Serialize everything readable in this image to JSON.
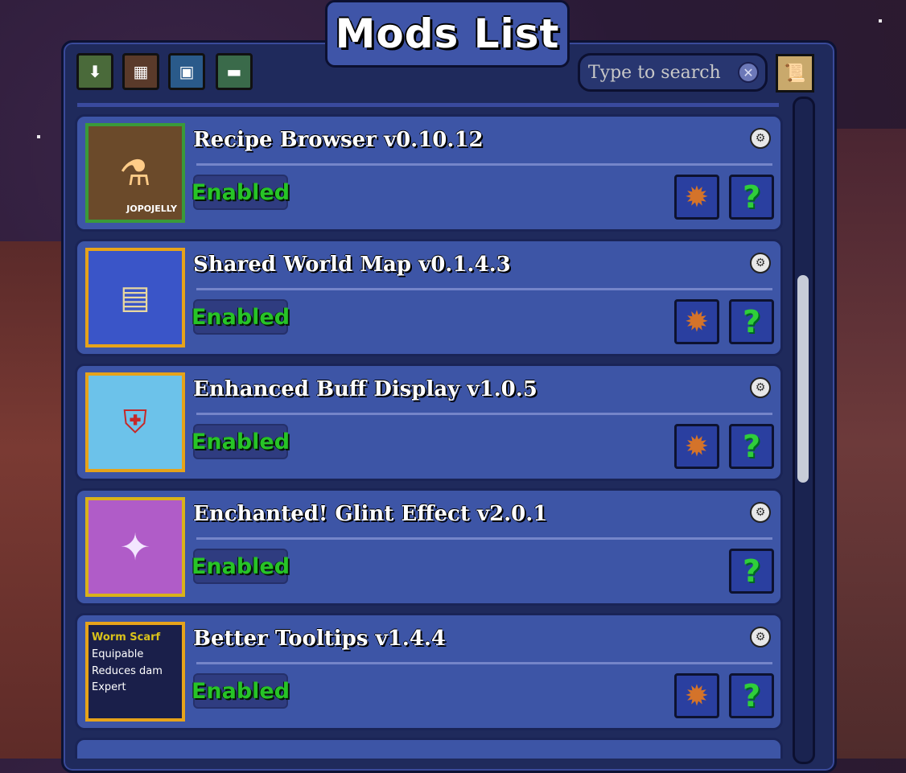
{
  "title": "Mods List",
  "toolbar": {
    "icons": [
      "download-mods-icon",
      "mod-browser-icon",
      "mod-sources-icon",
      "mod-pack-icon"
    ]
  },
  "search": {
    "placeholder": "Type to search",
    "value": ""
  },
  "mods": [
    {
      "name": "Recipe Browser v0.10.12",
      "status": "Enabled",
      "has_config": true,
      "thumb_label": "JOPOJELLY",
      "border": "#3a9a3a",
      "bg": "#6b4a2a"
    },
    {
      "name": "Shared World Map v0.1.4.3",
      "status": "Enabled",
      "has_config": true,
      "thumb_label": "",
      "border": "#e6a31a",
      "bg": "#3a55c8"
    },
    {
      "name": "Enhanced Buff Display v1.0.5",
      "status": "Enabled",
      "has_config": true,
      "thumb_label": "",
      "border": "#e6a31a",
      "bg": "#6cc2ea"
    },
    {
      "name": "Enchanted! Glint Effect v2.0.1",
      "status": "Enabled",
      "has_config": false,
      "thumb_label": "",
      "border": "#d9b21a",
      "bg": "#b05cc8"
    },
    {
      "name": "Better Tooltips v1.4.4",
      "status": "Enabled",
      "has_config": true,
      "thumb_lines": [
        "Worm Scarf",
        "Equipable",
        "Reduces dam",
        "Expert"
      ],
      "border": "#e6a31a",
      "bg": "#1a1f4a"
    }
  ]
}
